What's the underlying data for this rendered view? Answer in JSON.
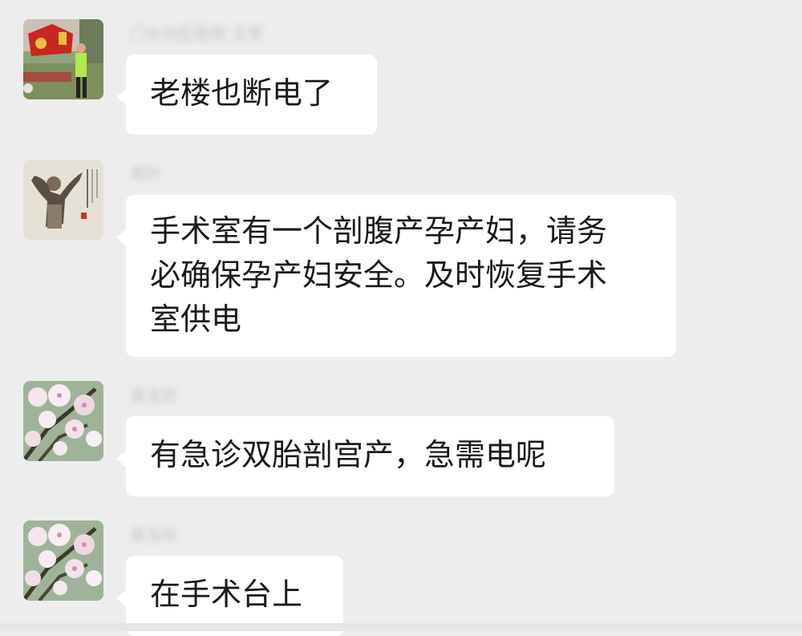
{
  "messages": [
    {
      "sender": "门头沟区医院 王军",
      "avatar_icon": "party-emblem-person-avatar",
      "lines": [
        "老楼也断电了"
      ]
    },
    {
      "sender": "荷叶",
      "avatar_icon": "calligraphy-figure-avatar",
      "lines": [
        "手术室有一个剖腹产孕产妇，请务",
        "必确保孕产妇安全。及时恢复手术",
        "室供电"
      ]
    },
    {
      "sender": "吴玉珍",
      "avatar_icon": "apple-blossom-avatar",
      "lines": [
        "有急诊双胎剖宫产，急需电呢"
      ]
    },
    {
      "sender": "吴玉珍",
      "avatar_icon": "apple-blossom-avatar",
      "lines": [
        "在手术台上"
      ]
    }
  ],
  "colors": {
    "background": "#ededed",
    "bubble": "#ffffff",
    "text": "#1a1a1a",
    "name": "#b2b2b2"
  }
}
